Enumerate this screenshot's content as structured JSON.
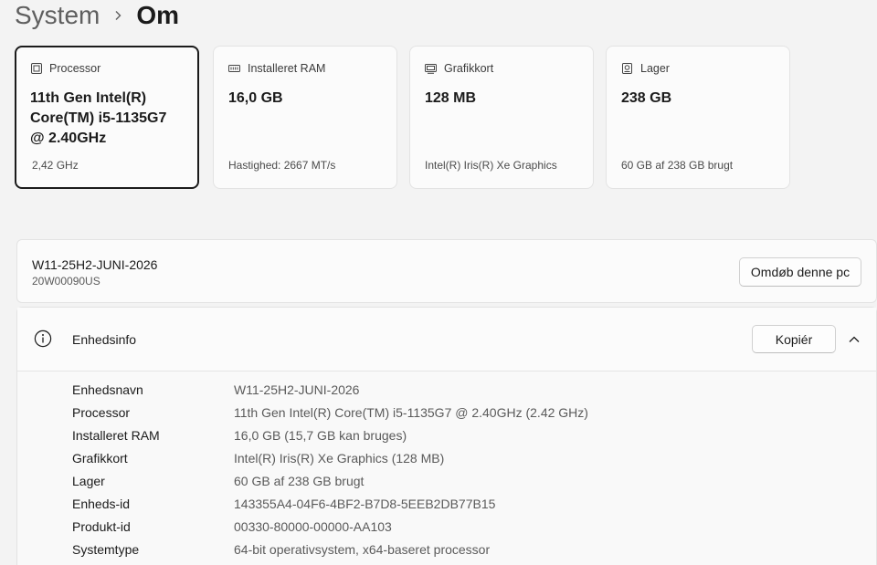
{
  "breadcrumb": {
    "parent": "System",
    "current": "Om"
  },
  "cards": [
    {
      "icon": "processor-icon",
      "label": "Processor",
      "value": "11th Gen Intel(R) Core(TM) i5-1135G7 @ 2.40GHz",
      "sub": "2,42 GHz",
      "selected": true
    },
    {
      "icon": "ram-icon",
      "label": "Installeret RAM",
      "value": "16,0 GB",
      "sub": "Hastighed: 2667 MT/s"
    },
    {
      "icon": "graphics-card-icon",
      "label": "Grafikkort",
      "value": "128 MB",
      "sub": "Intel(R) Iris(R) Xe Graphics"
    },
    {
      "icon": "storage-icon",
      "label": "Lager",
      "value": "238 GB",
      "sub": "60 GB af 238 GB brugt"
    }
  ],
  "device": {
    "name": "W11-25H2-JUNI-2026",
    "model": "20W00090US",
    "rename_label": "Omdøb denne pc"
  },
  "info": {
    "title": "Enhedsinfo",
    "copy_label": "Kopiér",
    "rows": [
      {
        "label": "Enhedsnavn",
        "value": "W11-25H2-JUNI-2026"
      },
      {
        "label": "Processor",
        "value": "11th Gen Intel(R) Core(TM) i5-1135G7 @ 2.40GHz (2.42 GHz)"
      },
      {
        "label": "Installeret RAM",
        "value": "16,0 GB (15,7 GB kan bruges)"
      },
      {
        "label": "Grafikkort",
        "value": "Intel(R) Iris(R) Xe Graphics (128 MB)"
      },
      {
        "label": "Lager",
        "value": "60 GB af 238 GB brugt"
      },
      {
        "label": "Enheds-id",
        "value": "143355A4-04F6-4BF2-B7D8-5EEB2DB77B15"
      },
      {
        "label": "Produkt-id",
        "value": "00330-80000-00000-AA103"
      },
      {
        "label": "Systemtype",
        "value": "64-bit operativsystem, x64-baseret processor"
      }
    ]
  }
}
